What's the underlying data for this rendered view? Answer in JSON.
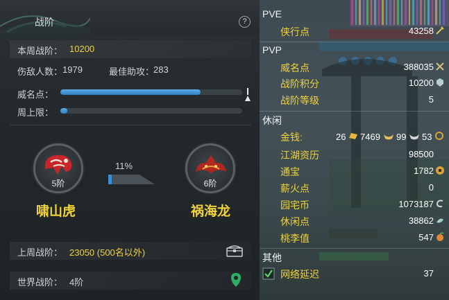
{
  "left_panel": {
    "title": "战阶",
    "help": "?",
    "week_rank_label": "本周战阶：",
    "week_rank_value": "10200",
    "damage_label": "伤敌人数：",
    "damage_value": "1979",
    "assist_label": "最佳助攻：",
    "assist_value": "283",
    "prestige_label": "威名点：",
    "prestige_fill": 0.77,
    "weekly_cap_label": "周上限：",
    "weekly_cap_fill": 0.04,
    "current_rank": {
      "level": "5阶",
      "name": "啸山虎"
    },
    "next_rank": {
      "level": "6阶",
      "name": "祸海龙"
    },
    "progress_percent": "11%",
    "progress_fill": 0.11,
    "last_week_label": "上周战阶：",
    "last_week_value": "23050 (500名以外)",
    "world_rank_label": "世界战阶：",
    "world_rank_value": "4阶"
  },
  "right_panel": {
    "sections": {
      "pve": "PVE",
      "pvp": "PVP",
      "leisure": "休闲",
      "other": "其他"
    },
    "pve_rows": [
      {
        "label": "侠行点",
        "value": "43258",
        "icon": "sword-icon"
      }
    ],
    "pvp_rows": [
      {
        "label": "威名点",
        "value": "388035",
        "icon": "prestige-icon"
      },
      {
        "label": "战阶积分",
        "value": "10200",
        "icon": "crest-icon"
      },
      {
        "label": "战阶等级",
        "value": "5"
      }
    ],
    "money": {
      "label": "金钱:",
      "gold": "26",
      "silver": "7469",
      "copper": "99",
      "ingot": "53"
    },
    "leisure_rows": [
      {
        "label": "江湖资历",
        "value": "98500"
      },
      {
        "label": "通宝",
        "value": "1782",
        "icon": "coin-icon"
      },
      {
        "label": "薪火点",
        "value": "0"
      },
      {
        "label": "园宅币",
        "value": "1073187",
        "icon": "house-coin-icon"
      },
      {
        "label": "休闲点",
        "value": "38862",
        "icon": "leisure-icon"
      },
      {
        "label": "桃李值",
        "value": "547",
        "icon": "peach-icon"
      }
    ],
    "other_rows": [
      {
        "label": "网络延迟",
        "value": "37",
        "checked": true
      }
    ]
  },
  "colors": {
    "accent_yellow": "#f0d33a",
    "bar_blue": "#3a8fd6",
    "check_green": "#5fd06a"
  }
}
